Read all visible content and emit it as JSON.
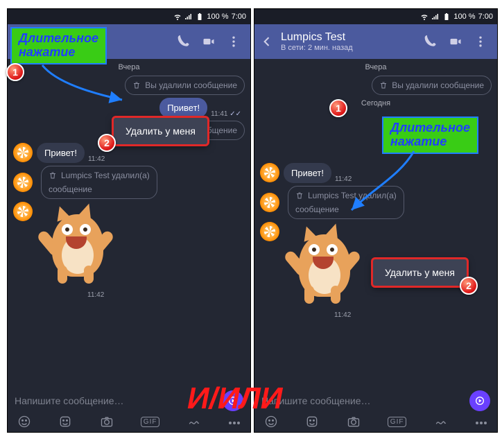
{
  "status": {
    "battery": "100 %",
    "time": "7:00"
  },
  "header": {
    "title": "Lumpics Test",
    "status": "В сети: 2 мин. назад"
  },
  "days": {
    "yesterday": "Вчера",
    "today": "Сегодня"
  },
  "msg": {
    "you_deleted": "Вы удалили сообщение",
    "hello": "Привет!",
    "peer_deleted_l1": "Lumpics Test удалил(а)",
    "peer_deleted_l2": "сообщение"
  },
  "times": {
    "t1": "11:41",
    "t2": "11:42"
  },
  "ctx": {
    "delete_for_me": "Удалить у меня"
  },
  "callout": {
    "l1": "Длительное",
    "l2": "нажатие",
    "n1": "1",
    "n2": "2"
  },
  "composer": {
    "placeholder": "Напишите сообщение…",
    "gif": "GIF"
  },
  "or": "И/ИЛИ"
}
